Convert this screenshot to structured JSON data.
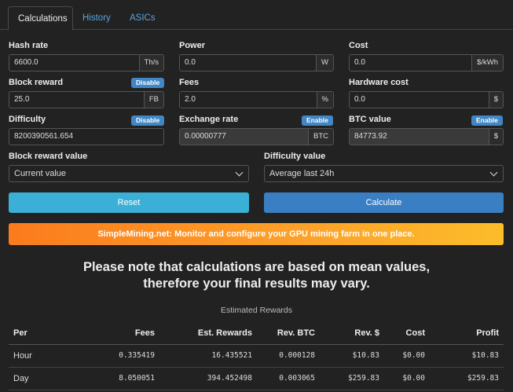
{
  "tabs": [
    {
      "label": "Calculations"
    },
    {
      "label": "History"
    },
    {
      "label": "ASICs"
    }
  ],
  "fields": {
    "hash_rate": {
      "label": "Hash rate",
      "value": "6600.0",
      "unit": "Th/s"
    },
    "power": {
      "label": "Power",
      "value": "0.0",
      "unit": "W"
    },
    "cost": {
      "label": "Cost",
      "value": "0.0",
      "unit": "$/kWh"
    },
    "block_reward": {
      "label": "Block reward",
      "toggle": "Disable",
      "value": "25.0",
      "unit": "FB"
    },
    "fees": {
      "label": "Fees",
      "value": "2.0",
      "unit": "%"
    },
    "hardware_cost": {
      "label": "Hardware cost",
      "value": "0.0",
      "unit": "$"
    },
    "difficulty": {
      "label": "Difficulty",
      "toggle": "Disable",
      "value": "8200390561.654"
    },
    "exchange_rate": {
      "label": "Exchange rate",
      "toggle": "Enable",
      "value": "0.00000777",
      "unit": "BTC"
    },
    "btc_value": {
      "label": "BTC value",
      "toggle": "Enable",
      "value": "84773.92",
      "unit": "$"
    }
  },
  "selects": {
    "block_reward_value": {
      "label": "Block reward value",
      "selected": "Current value"
    },
    "difficulty_value": {
      "label": "Difficulty value",
      "selected": "Average last 24h"
    }
  },
  "buttons": {
    "reset": "Reset",
    "calculate": "Calculate"
  },
  "colors": {
    "reset": "#3bb0d6",
    "calculate": "#3a7fc3",
    "accent_link": "#5aa5dd"
  },
  "banner": "SimpleMining.net: Monitor and configure your GPU mining farm in one place.",
  "note": {
    "line1": "Please note that calculations are based on mean values,",
    "line2": "therefore your final results may vary."
  },
  "table": {
    "caption": "Estimated Rewards",
    "headers": [
      "Per",
      "Fees",
      "Est. Rewards",
      "Rev. BTC",
      "Rev. $",
      "Cost",
      "Profit"
    ],
    "rows": [
      [
        "Hour",
        "0.335419",
        "16.435521",
        "0.000128",
        "$10.83",
        "$0.00",
        "$10.83"
      ],
      [
        "Day",
        "8.050051",
        "394.452498",
        "0.003065",
        "$259.83",
        "$0.00",
        "$259.83"
      ]
    ]
  }
}
